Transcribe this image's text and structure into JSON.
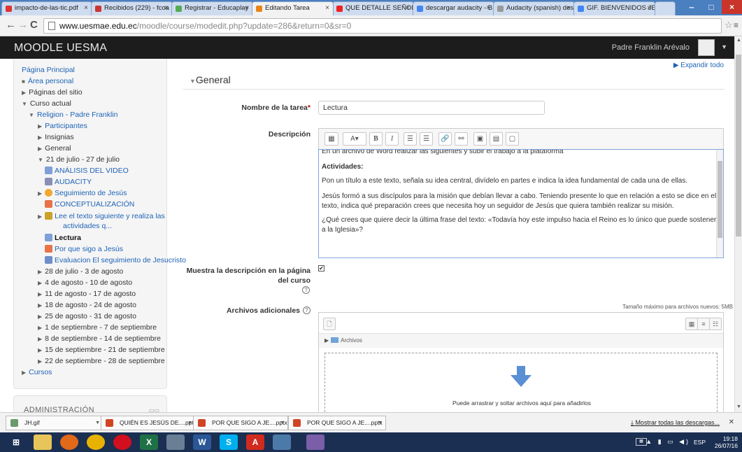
{
  "browser": {
    "tabs": [
      {
        "label": "impacto-de-las-tic.pdf",
        "icon": "pdf-icon"
      },
      {
        "label": "Recibidos (229) - fcoa",
        "icon": "gmail-icon"
      },
      {
        "label": "Registrar - Educaplay",
        "icon": "educaplay-icon"
      },
      {
        "label": "Editando Tarea",
        "icon": "moodle-icon"
      },
      {
        "label": "QUE DETALLE SEÑOR",
        "icon": "youtube-icon"
      },
      {
        "label": "descargar audacity - B",
        "icon": "google-icon"
      },
      {
        "label": "Audacity (spanish) des",
        "icon": "globe-icon"
      },
      {
        "label": "GIF. BIENVENIDOS JES",
        "icon": "google-icon"
      }
    ],
    "url_host": "www.uesmae.edu.ec",
    "url_path": "/moodle/course/modedit.php?update=286&return=0&sr=0"
  },
  "moodle": {
    "site_name": "MOODLE UESMA",
    "user_name": "Padre Franklin Arévalo"
  },
  "nav": {
    "home": "Página Principal",
    "items": [
      {
        "label": "Área personal"
      },
      {
        "label": "Páginas del sitio"
      },
      {
        "label": "Curso actual"
      },
      {
        "label": "Religion - Padre Franklin"
      },
      {
        "label": "Participantes"
      },
      {
        "label": "Insignias"
      },
      {
        "label": "General"
      },
      {
        "label": "21 de julio - 27 de julio"
      },
      {
        "label": "ANÁLISIS DEL VIDEO"
      },
      {
        "label": "AUDACITY"
      },
      {
        "label": "Seguimiento de Jesús"
      },
      {
        "label": "CONCEPTUALIZACIÓN"
      },
      {
        "label": "Lee el texto siguiente y realiza las"
      },
      {
        "label": "actividades q..."
      },
      {
        "label": "Lectura"
      },
      {
        "label": "Por que sigo a Jesús"
      },
      {
        "label": "Evaluacion El seguimiento de Jesucristo"
      },
      {
        "label": "28 de julio - 3 de agosto"
      },
      {
        "label": "4 de agosto - 10 de agosto"
      },
      {
        "label": "11 de agosto - 17 de agosto"
      },
      {
        "label": "18 de agosto - 24 de agosto"
      },
      {
        "label": "25 de agosto - 31 de agosto"
      },
      {
        "label": "1 de septiembre - 7 de septiembre"
      },
      {
        "label": "8 de septiembre - 14 de septiembre"
      },
      {
        "label": "15 de septiembre - 21 de septiembre"
      },
      {
        "label": "22 de septiembre - 28 de septiembre"
      },
      {
        "label": "Cursos"
      }
    ],
    "admin_title": "ADMINISTRACIÓN"
  },
  "form": {
    "expand_all": "Expandir todo",
    "section": "General",
    "name_label": "Nombre de la tarea",
    "name_value": "Lectura",
    "description_label": "Descripción",
    "editor": {
      "line0": "En un archivo de Word realizar las siguientes y subir el trabajo a la plataforma",
      "heading": "Actividades:",
      "p1": "Pon un título a este texto, señala su idea central, divídelo en partes e indica la idea fundamental de cada una de ellas.",
      "p2": "Jesús formó a sus discípulos para la misión que debían llevar a cabo. Teniendo presente lo que en relación a esto se dice en el texto, indica qué preparación crees que necesita hoy un seguidor de Jesús que quiera también realizar su misión.",
      "p3": "¿Qué crees que quiere decir la última frase del texto: «Todavía hoy este impulso hacia el Reino es lo único que puede sostener a la Iglesia»?"
    },
    "show_desc_label_1": "Muestra la descripción en la página",
    "show_desc_label_2": "del curso",
    "show_desc_checked": true,
    "files_label": "Archivos adicionales",
    "max_size": "Tamaño máximo para archivos nuevos: 5MB",
    "folder": "Archivos",
    "drop_text": "Puede arrastrar y soltar archivos aquí para añadirlos"
  },
  "downloads": {
    "items": [
      {
        "label": "JH.gif"
      },
      {
        "label": "QUIÉN ES JESÚS DE....pptx"
      },
      {
        "label": "POR QUE SIGO A JE....pptx"
      },
      {
        "label": "POR QUE SIGO A JE....pptx"
      }
    ],
    "show_all": "Mostrar todas las descargas..."
  },
  "taskbar": {
    "lang": "ESP",
    "time": "19:18",
    "date": "26/07/16"
  },
  "colors": {
    "link": "#1e63b7",
    "navbar": "#1c1c1c",
    "required": "#c00000"
  }
}
